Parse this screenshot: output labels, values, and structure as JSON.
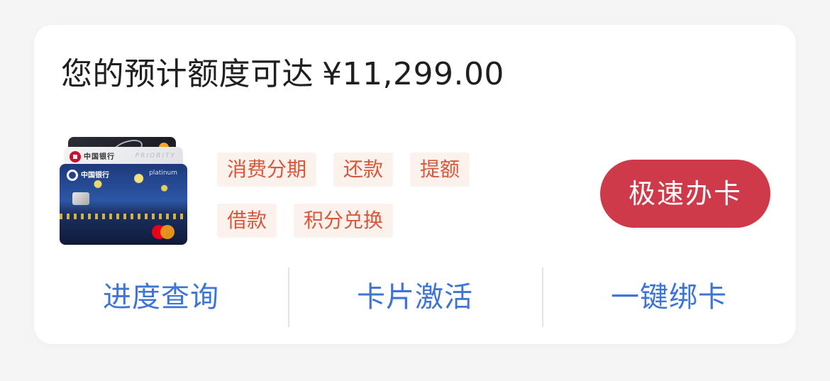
{
  "headline": {
    "label": "您的预计额度可达",
    "amount": "¥11,299.00"
  },
  "card_images": {
    "front_bank_text": "中国银行",
    "mid_bank_text": "中国银行",
    "mid_priority_text": "PRIORITY",
    "front_tier_text": "platinum",
    "icons": [
      "bank-logo-icon",
      "chip-icon",
      "mastercard-icon"
    ]
  },
  "services": {
    "row1": [
      "消费分期",
      "还款",
      "提额"
    ],
    "row2": [
      "借款",
      "积分兑换"
    ]
  },
  "cta": {
    "label": "极速办卡"
  },
  "bottom_nav": [
    "进度查询",
    "卡片激活",
    "一键绑卡"
  ],
  "colors": {
    "accent_red": "#cf3a4a",
    "tag_text": "#d9573a",
    "tag_bg": "#fbf2ee",
    "link_blue": "#3d74d6"
  }
}
